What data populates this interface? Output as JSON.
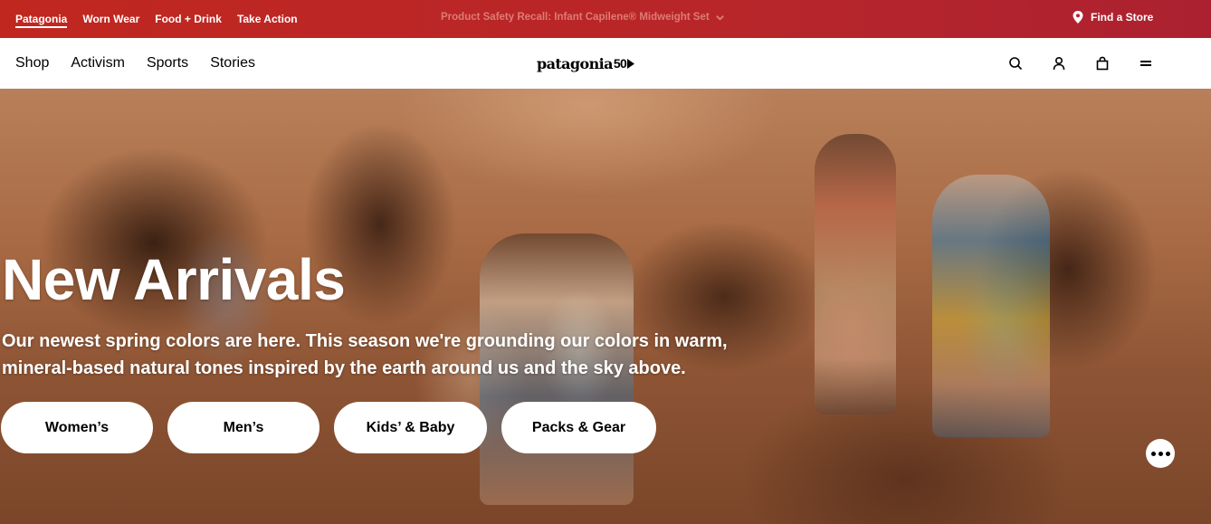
{
  "topbar": {
    "brands": [
      "Patagonia",
      "Worn Wear",
      "Food + Drink",
      "Take Action"
    ],
    "active_brand": "Patagonia",
    "recall_text": "Product Safety Recall: Infant Capilene® Midweight Set",
    "find_store": "Find a Store",
    "background": "#b8262a"
  },
  "nav": {
    "links": [
      "Shop",
      "Activism",
      "Sports",
      "Stories"
    ],
    "logo_text": "patagonia",
    "logo_suffix": "50",
    "icons": [
      "search-icon",
      "account-icon",
      "bag-icon",
      "menu-icon"
    ]
  },
  "hero": {
    "title": "New Arrivals",
    "subtitle_line1": "Our newest spring colors are here. This season we're grounding our colors in warm,",
    "subtitle_line2": "mineral-based natural tones inspired by the earth around us and the sky above.",
    "buttons": [
      "Women’s",
      "Men’s",
      "Kids’ & Baby",
      "Packs & Gear"
    ],
    "more_button_icon": "more-dots-icon"
  }
}
